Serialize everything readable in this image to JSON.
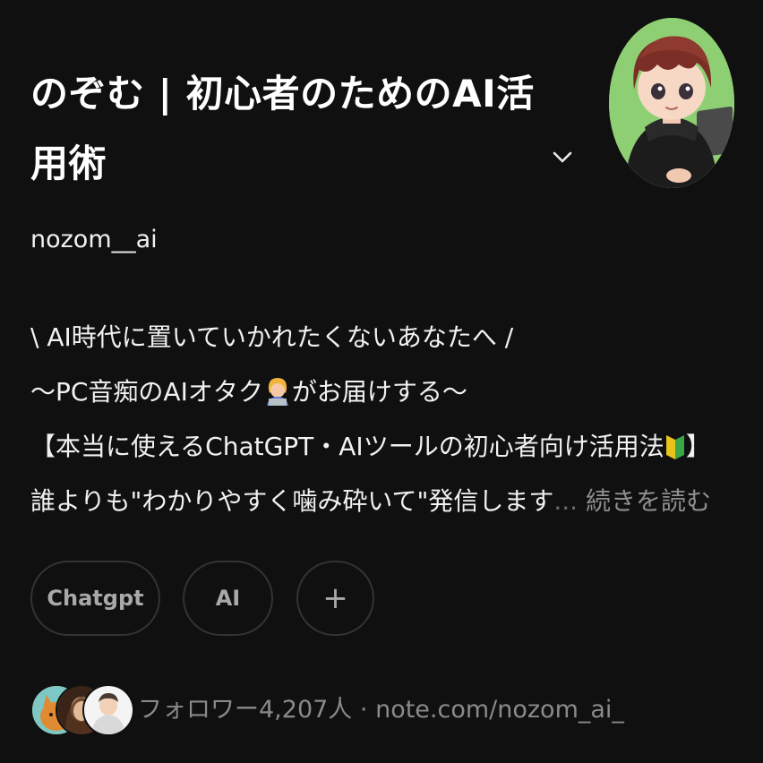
{
  "profile": {
    "title_line1": "のぞむ | 初心者のためのAI活",
    "title_line2": "用術",
    "username": "nozom__ai"
  },
  "bio": {
    "line1": "\\ AI時代に置いていかれたくないあなたへ /",
    "line2_before": "〜PC音痴のAIオタク",
    "line2_after": "がお届けする〜",
    "line3_before": "【本当に使えるChatGPT・AIツールの初心者向け活用法",
    "line3_after": "】",
    "line4": "誰よりも\"わかりやすく噛み砕いて\"発信します",
    "ellipsis": "...",
    "read_more": "続きを読む"
  },
  "tags": [
    {
      "label": "Chatgpt"
    },
    {
      "label": "AI"
    },
    {
      "label": "+"
    }
  ],
  "footer": {
    "followers_label": "フォロワー",
    "followers_count": "4,207",
    "followers_unit": "人",
    "separator": "·",
    "link": "note.com/nozom_ai_"
  },
  "icons": [
    "chevron-down-icon",
    "technologist-emoji-icon",
    "beginner-mark-icon"
  ],
  "colors": {
    "background": "#101010",
    "text": "#f3f3f3",
    "muted": "#8a8a8a",
    "tag_border": "#333333"
  }
}
